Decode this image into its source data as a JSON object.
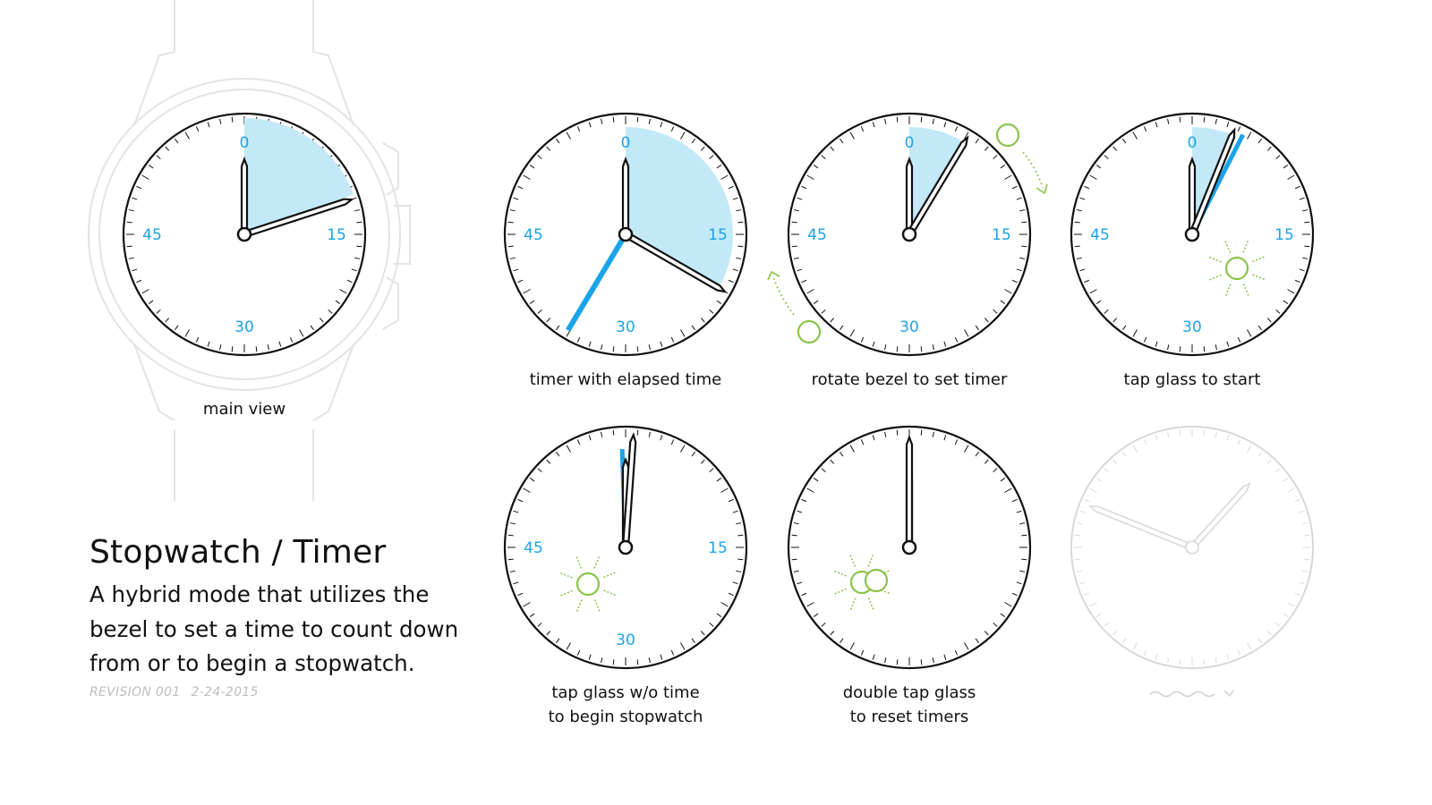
{
  "colors": {
    "accent_blue": "#1aa3e8",
    "fill_blue": "#c3e9f8",
    "tap_green": "#8bc34a",
    "ghost_gray": "#d8d8d8",
    "ink": "#111111"
  },
  "dial_numbers": [
    "0",
    "15",
    "30",
    "45"
  ],
  "dials": {
    "main_view": {
      "caption": "main view"
    },
    "timer_elapsed": {
      "caption": "timer with elapsed time"
    },
    "rotate_bezel": {
      "caption": "rotate bezel to set timer"
    },
    "tap_start": {
      "caption": "tap glass to start"
    },
    "tap_stopwatch": {
      "caption_line1": "tap glass w/o time",
      "caption_line2": "to begin stopwatch"
    },
    "double_tap": {
      "caption_line1": "double tap glass",
      "caption_line2": "to reset timers"
    },
    "ghost": {
      "caption": ""
    }
  },
  "text": {
    "title": "Stopwatch / Timer",
    "description": "A hybrid mode that utilizes the bezel to set a time to count down from or to begin a stopwatch.",
    "revision": "REVISION 001",
    "date": "2-24-2015"
  },
  "icons": {
    "tap": "tap-glass-icon",
    "double_tap": "double-tap-icon",
    "rotate": "rotate-arrow-icon"
  }
}
